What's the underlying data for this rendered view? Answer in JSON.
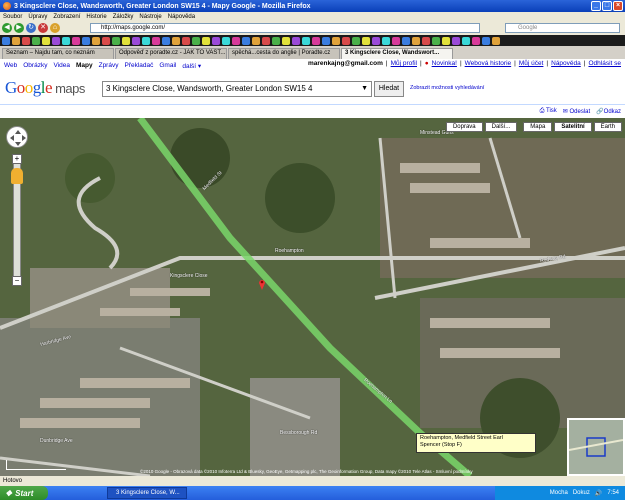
{
  "window": {
    "title": "3 Kingsclere Close, Wandsworth, Greater London SW15 4 - Mapy Google - Mozilla Firefox"
  },
  "menu": [
    "Soubor",
    "Úpravy",
    "Zobrazení",
    "Historie",
    "Záložky",
    "Nástroje",
    "Nápověda"
  ],
  "navbar": {
    "url": "http://maps.google.com/",
    "search_placeholder": "Google"
  },
  "tabs": [
    {
      "label": "Seznam – Najdu tam, co neznám"
    },
    {
      "label": "Odpověď z poradte.cz - JAK TO VAST..."
    },
    {
      "label": "spěchá...cesta do anglie | Poradte.cz"
    },
    {
      "label": "3 Kingsclere Close, Wandswort..."
    }
  ],
  "gbar": {
    "links": [
      "Web",
      "Obrázky",
      "Videa",
      "Mapy",
      "Zprávy",
      "Překladač",
      "Gmail",
      "další ▾"
    ],
    "account": "marenkajng@gmail.com",
    "right_links": [
      "Můj profil",
      "Novinka!",
      "Webová historie",
      "Můj účet",
      "Nápověda",
      "Odhlásit se"
    ]
  },
  "logo": {
    "google": "Google",
    "maps": "maps"
  },
  "search": {
    "value": "3 Kingsclere Close, Wandsworth, Greater London SW15 4",
    "button": "Hledat",
    "options": "Zobrazit možnosti vyhledávání"
  },
  "print": {
    "print": "Tisk",
    "send": "Odeslat",
    "link": "Odkaz"
  },
  "mapctl": {
    "traffic": "Doprava",
    "more": "Další...",
    "map": "Mapa",
    "satellite": "Satelitní",
    "earth": "Earth"
  },
  "tooltip": {
    "line1": "Roehampton, Medfield Street Earl",
    "line2": "Spencer (Stop F)"
  },
  "map_labels": [
    {
      "text": "Kingsclere Close"
    },
    {
      "text": "Roehampton"
    },
    {
      "text": "Medfield St"
    },
    {
      "text": "Roehampton Ln"
    },
    {
      "text": "Rodway Rd"
    },
    {
      "text": "Dunbridge Ave"
    },
    {
      "text": "Minstead Gdns"
    },
    {
      "text": "Bessborough Rd"
    },
    {
      "text": "Harbridge Ave"
    }
  ],
  "copyright": "©2010 Google - Obrazová data ©2010 Infoterra Ltd & Bluesky, GeoEye, Getmapping plc, The Geoinformation Group, Data mapy ©2010 Tele Atlas - Smluvní podmínky",
  "status": "Hotovo",
  "taskbar": {
    "start": "Start",
    "item": "3 Kingsclere Close, W...",
    "tray_lang": "Mocha",
    "tray_dokuz": "Dokuz",
    "time": "7:54"
  }
}
